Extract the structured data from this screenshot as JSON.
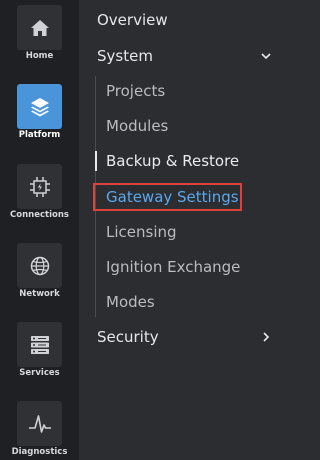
{
  "rail": {
    "items": [
      {
        "label": "Home",
        "icon": "home-icon",
        "active": false
      },
      {
        "label": "Platform",
        "icon": "layers-icon",
        "active": true
      },
      {
        "label": "Connections",
        "icon": "connections-icon",
        "active": false
      },
      {
        "label": "Network",
        "icon": "globe-icon",
        "active": false
      },
      {
        "label": "Services",
        "icon": "server-icon",
        "active": false
      },
      {
        "label": "Diagnostics",
        "icon": "pulse-icon",
        "active": false
      }
    ]
  },
  "nav": {
    "overview": "Overview",
    "system": {
      "label": "System",
      "expanded": true,
      "children": [
        {
          "label": "Projects"
        },
        {
          "label": "Modules"
        },
        {
          "label": "Backup & Restore"
        },
        {
          "label": "Gateway Settings"
        },
        {
          "label": "Licensing"
        },
        {
          "label": "Ignition Exchange"
        },
        {
          "label": "Modes"
        }
      ]
    },
    "security": {
      "label": "Security",
      "expanded": false
    }
  },
  "colors": {
    "accent": "#4a95d9",
    "selected_text": "#5aa8ec",
    "highlight_border": "#e0413a"
  }
}
